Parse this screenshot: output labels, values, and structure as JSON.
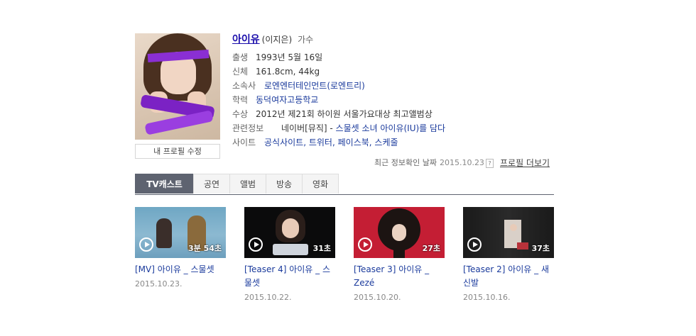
{
  "profile": {
    "name": "아이유",
    "real_name": "(이지은)",
    "job": "가수",
    "edit_label": "내 프로필 수정",
    "rows": [
      {
        "label": "출생",
        "value": "1993년 5월 16일"
      },
      {
        "label": "신체",
        "value": "161.8cm, 44kg"
      },
      {
        "label": "소속사",
        "value": "로엔엔터테인먼트(로엔트리)"
      },
      {
        "label": "학력",
        "value": "동덕여자고등학교"
      },
      {
        "label": "수상",
        "value": "2012년 제21회 하이원 서울가요대상 최고앨범상"
      },
      {
        "label": "관련정보",
        "value": "네이버[뮤직] - 스물셋 소녀 아이유(IU)를 담다"
      },
      {
        "label": "사이트",
        "value": "공식사이트, 트위터, 페이스북, 스케줄"
      }
    ],
    "related_prefix": "네이버[뮤직] - ",
    "related_link": "스물셋 소녀 아이유(IU)를 담다",
    "sites": [
      "공식사이트",
      "트위터",
      "페이스북",
      "스케줄"
    ],
    "last_checked_label": "최근 정보확인 날짜",
    "last_checked_date": "2015.10.23",
    "help_glyph": "?",
    "more_label": "프로필 더보기"
  },
  "tabs": [
    "TV캐스트",
    "공연",
    "앨범",
    "방송",
    "영화"
  ],
  "videos": [
    {
      "title_line1": "[MV] 아이유 _ 스물셋",
      "title_line2": "",
      "date": "2015.10.23.",
      "duration": "3분 54초"
    },
    {
      "title_line1": "[Teaser 4] 아이유 _ 스",
      "title_line2": "물셋",
      "date": "2015.10.22.",
      "duration": "31초"
    },
    {
      "title_line1": "[Teaser 3] 아이유 _",
      "title_line2": "Zezé",
      "date": "2015.10.20.",
      "duration": "27초"
    },
    {
      "title_line1": "[Teaser 2] 아이유 _ 새",
      "title_line2": "신발",
      "date": "2015.10.16.",
      "duration": "37초"
    }
  ],
  "colors": {
    "link": "#1a3a9c",
    "name": "#1a0dab",
    "tab_active": "#5e6370"
  }
}
